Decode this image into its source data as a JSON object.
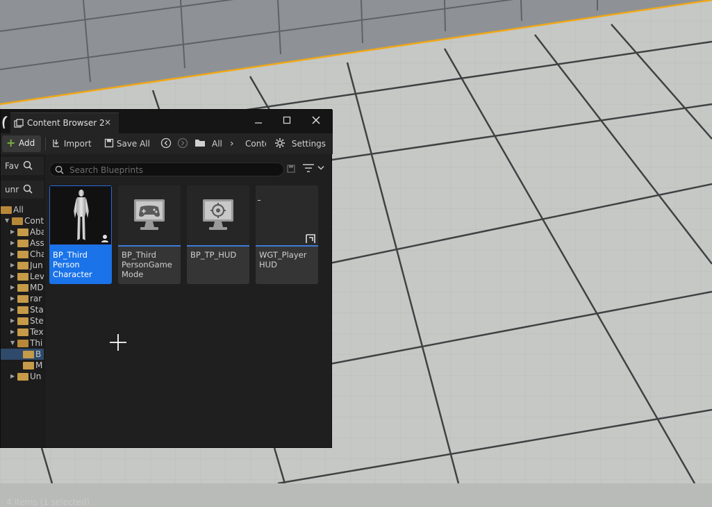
{
  "window": {
    "tab_title": "Content Browser 2",
    "tab_close": "×",
    "minimize": "—",
    "maximize": "☐",
    "close": "✕"
  },
  "toolbar": {
    "add_label": "Add",
    "import_label": "Import",
    "save_all_label": "Save All",
    "path_all": "All",
    "path_content": "Conte",
    "path_sep": "›",
    "settings_label": "Settings"
  },
  "sidebar": {
    "favorites_label": "Fav",
    "collection_label": "unr",
    "tree": [
      {
        "label": "All",
        "level": 0,
        "open": true
      },
      {
        "label": "Content",
        "level": 1,
        "open": true
      },
      {
        "label": "Aba",
        "level": 2,
        "open": false
      },
      {
        "label": "Ass",
        "level": 2,
        "open": false
      },
      {
        "label": "Cha",
        "level": 2,
        "open": false
      },
      {
        "label": "Jun",
        "level": 2,
        "open": false
      },
      {
        "label": "Lev",
        "level": 2,
        "open": false
      },
      {
        "label": "MD",
        "level": 2,
        "open": false
      },
      {
        "label": "rar",
        "level": 2,
        "open": false
      },
      {
        "label": "Sta",
        "level": 2,
        "open": false
      },
      {
        "label": "Ste",
        "level": 2,
        "open": false
      },
      {
        "label": "Tex",
        "level": 2,
        "open": false
      },
      {
        "label": "Thi",
        "level": 2,
        "open": true
      },
      {
        "label": "B",
        "level": 3,
        "open": false,
        "selected": true
      },
      {
        "label": "M",
        "level": 3,
        "open": false
      },
      {
        "label": "Un",
        "level": 2,
        "open": false
      }
    ]
  },
  "search": {
    "placeholder": "Search Blueprints",
    "value": ""
  },
  "assets": [
    {
      "name": "BP_Third Person Character",
      "line1": "BP_Third",
      "line2": "Person",
      "line3": "Character",
      "icon": "character-icon",
      "selected": true
    },
    {
      "name": "BP_Third PersonGame Mode",
      "line1": "BP_Third",
      "line2": "PersonGame",
      "line3": "Mode",
      "icon": "gamepad-icon",
      "selected": false
    },
    {
      "name": "BP_TP_HUD",
      "line1": "BP_TP_HUD",
      "line2": "",
      "line3": "",
      "icon": "crosshair-icon",
      "selected": false
    },
    {
      "name": "WGT_Player HUD",
      "line1": "WGT_Player",
      "line2": "HUD",
      "line3": "",
      "icon": "widget-icon",
      "selected": false
    }
  ],
  "status": {
    "text": "4 items (1 selected)"
  },
  "colors": {
    "accent": "#1a73e8",
    "folder": "#c59a48",
    "add_green": "#7cb342",
    "floor_line": "#f0a818"
  }
}
